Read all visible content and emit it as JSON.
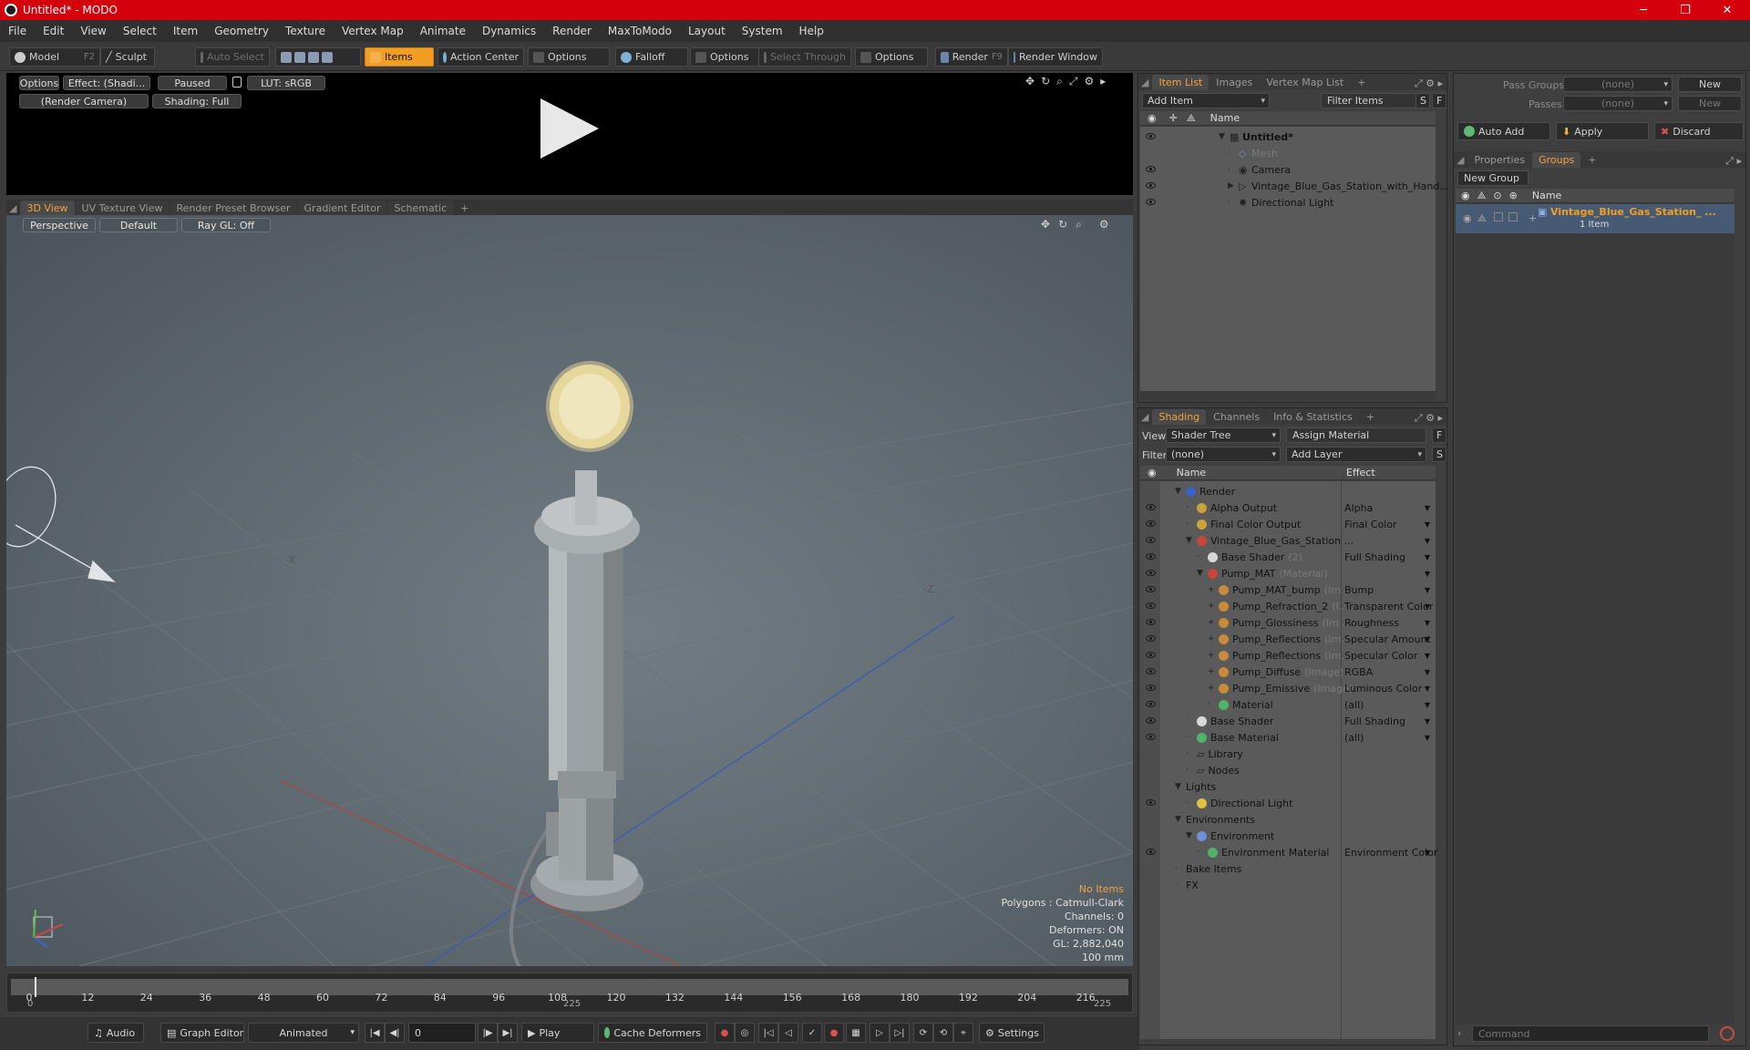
{
  "window": {
    "title": "Untitled* - MODO",
    "minimize": "─",
    "maximize": "❐",
    "close": "✕"
  },
  "menu": [
    "File",
    "Edit",
    "View",
    "Select",
    "Item",
    "Geometry",
    "Texture",
    "Vertex Map",
    "Animate",
    "Dynamics",
    "Render",
    "MaxToModo",
    "Layout",
    "System",
    "Help"
  ],
  "toolbar": {
    "model": "Model",
    "model_key": "F2",
    "sculpt": "Sculpt",
    "auto_select": "Auto Select",
    "items": "Items",
    "action_center": "Action Center",
    "options1": "Options",
    "falloff": "Falloff",
    "options2": "Options",
    "select_through": "Select Through",
    "options3": "Options",
    "render": "Render",
    "render_key": "F9",
    "render_window": "Render Window"
  },
  "render_view": {
    "options": "Options",
    "effect": "Effect: (Shadi...",
    "paused": "Paused",
    "lut": "LUT: sRGB",
    "camera": "(Render Camera)",
    "shading": "Shading: Full"
  },
  "view_tabs": [
    "3D View",
    "UV Texture View",
    "Render Preset Browser",
    "Gradient Editor",
    "Schematic"
  ],
  "viewport": {
    "perspective": "Perspective",
    "default": "Default",
    "raygl": "Ray GL: Off",
    "axis_x": "-X",
    "axis_z": "-Z",
    "no_items": "No Items",
    "stats": [
      "Polygons : Catmull-Clark",
      "Channels: 0",
      "Deformers: ON",
      "GL: 2,882,040",
      "100 mm"
    ]
  },
  "timeline": {
    "ticks": [
      "0",
      "12",
      "24",
      "36",
      "48",
      "60",
      "72",
      "84",
      "96",
      "108",
      "120",
      "132",
      "144",
      "156",
      "168",
      "180",
      "192",
      "204",
      "216"
    ],
    "start": "0",
    "mid": "225",
    "end": "225"
  },
  "bottombar": {
    "audio": "Audio",
    "graph_editor": "Graph Editor",
    "animated": "Animated",
    "frame": "0",
    "play": "Play",
    "cache": "Cache Deformers",
    "settings": "Settings"
  },
  "item_list": {
    "tabs": [
      "Item List",
      "Images",
      "Vertex Map List"
    ],
    "add_item": "Add Item",
    "filter": "Filter Items",
    "s": "S",
    "f": "F",
    "name_header": "Name",
    "items": [
      {
        "label": "Untitled*",
        "indent": 0,
        "bold": true
      },
      {
        "label": "Mesh",
        "indent": 1,
        "gray": true
      },
      {
        "label": "Camera",
        "indent": 1
      },
      {
        "label": "Vintage_Blue_Gas_Station_with_Hand...",
        "indent": 1
      },
      {
        "label": "Directional Light",
        "indent": 1
      }
    ]
  },
  "shading": {
    "tabs": [
      "Shading",
      "Channels",
      "Info & Statistics"
    ],
    "view_label": "View",
    "view_value": "Shader Tree",
    "assign": "Assign Material",
    "f": "F",
    "filter_label": "Filter",
    "filter_value": "(none)",
    "add_layer": "Add Layer",
    "s": "S",
    "name_header": "Name",
    "effect_header": "Effect",
    "rows": [
      {
        "name": "Render",
        "sub": "",
        "effect": "",
        "lvl": 0,
        "icon": "#3a63c9",
        "eye": false
      },
      {
        "name": "Alpha Output",
        "sub": "",
        "effect": "Alpha",
        "lvl": 1,
        "icon": "#c9a23a",
        "eye": true
      },
      {
        "name": "Final Color Output",
        "sub": "",
        "effect": "Final Color",
        "lvl": 1,
        "icon": "#c9a23a",
        "eye": true
      },
      {
        "name": "Vintage_Blue_Gas_Station ...",
        "sub": "",
        "effect": "",
        "lvl": 1,
        "icon": "#c9443a",
        "eye": true
      },
      {
        "name": "Base Shader",
        "sub": "(2)",
        "effect": "Full Shading",
        "lvl": 2,
        "icon": "#d8d8d8",
        "eye": true
      },
      {
        "name": "Pump_MAT",
        "sub": "(Material)",
        "effect": "",
        "lvl": 2,
        "icon": "#c9443a",
        "eye": true
      },
      {
        "name": "Pump_MAT_bump",
        "sub": "(Im ...",
        "effect": "Bump",
        "lvl": 3,
        "icon": "#c98a3a",
        "eye": true
      },
      {
        "name": "Pump_Refraction_2",
        "sub": "(I...",
        "effect": "Transparent Color",
        "lvl": 3,
        "icon": "#c98a3a",
        "eye": true
      },
      {
        "name": "Pump_Glossiness",
        "sub": "(Im ...",
        "effect": "Roughness",
        "lvl": 3,
        "icon": "#c98a3a",
        "eye": true
      },
      {
        "name": "Pump_Reflections",
        "sub": "(Im...",
        "effect": "Specular Amount",
        "lvl": 3,
        "icon": "#c98a3a",
        "eye": true
      },
      {
        "name": "Pump_Reflections",
        "sub": "(Im...",
        "effect": "Specular Color",
        "lvl": 3,
        "icon": "#c98a3a",
        "eye": true
      },
      {
        "name": "Pump_Diffuse",
        "sub": "(Image)",
        "effect": "RGBA",
        "lvl": 3,
        "icon": "#c98a3a",
        "eye": true
      },
      {
        "name": "Pump_Emissive",
        "sub": "(Image)",
        "effect": "Luminous Color",
        "lvl": 3,
        "icon": "#c98a3a",
        "eye": true
      },
      {
        "name": "Material",
        "sub": "",
        "effect": "(all)",
        "lvl": 3,
        "icon": "#4fb36a",
        "eye": true
      },
      {
        "name": "Base Shader",
        "sub": "",
        "effect": "Full Shading",
        "lvl": 1,
        "icon": "#d8d8d8",
        "eye": true
      },
      {
        "name": "Base Material",
        "sub": "",
        "effect": "(all)",
        "lvl": 1,
        "icon": "#4fb36a",
        "eye": true
      },
      {
        "name": "Library",
        "sub": "",
        "effect": "",
        "lvl": 1,
        "icon": "",
        "eye": false
      },
      {
        "name": "Nodes",
        "sub": "",
        "effect": "",
        "lvl": 1,
        "icon": "",
        "eye": false
      },
      {
        "name": "Lights",
        "sub": "",
        "effect": "",
        "lvl": 0,
        "icon": "",
        "eye": false
      },
      {
        "name": "Directional Light",
        "sub": "",
        "effect": "",
        "lvl": 1,
        "icon": "#e0c040",
        "eye": true
      },
      {
        "name": "Environments",
        "sub": "",
        "effect": "",
        "lvl": 0,
        "icon": "",
        "eye": false
      },
      {
        "name": "Environment",
        "sub": "",
        "effect": "",
        "lvl": 1,
        "icon": "#6f8fd6",
        "eye": false
      },
      {
        "name": "Environment Material",
        "sub": "",
        "effect": "Environment Color",
        "lvl": 2,
        "icon": "#4fb36a",
        "eye": true
      },
      {
        "name": "Bake Items",
        "sub": "",
        "effect": "",
        "lvl": 0,
        "icon": "",
        "eye": false
      },
      {
        "name": "FX",
        "sub": "",
        "effect": "",
        "lvl": 0,
        "icon": "",
        "eye": false
      }
    ]
  },
  "groups_panel": {
    "pass_groups_label": "Pass Groups",
    "pass_groups_value": "(none)",
    "new1": "New",
    "passes_label": "Passes",
    "passes_value": "(none)",
    "new2": "New",
    "auto_add": "Auto Add",
    "apply": "Apply",
    "discard": "Discard",
    "tabs": [
      "Properties",
      "Groups"
    ],
    "new_group": "New Group",
    "name_header": "Name",
    "group_name": "Vintage_Blue_Gas_Station_ ...",
    "group_count": "1 Item",
    "command_placeholder": "Command"
  },
  "colors": {
    "accent": "#f29d24",
    "title_red": "#d4000c"
  }
}
